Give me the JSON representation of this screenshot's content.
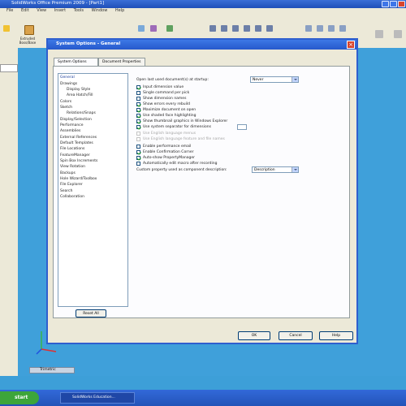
{
  "app": {
    "title": "SolidWorks Office Premium 2009 - [Part1]",
    "menu": [
      "File",
      "Edit",
      "View",
      "Insert",
      "Tools",
      "Window",
      "Help"
    ]
  },
  "toolbar": {
    "extruded_boss_label": "Extruded Boss/Base"
  },
  "status": {
    "tab_label": "Trimetric"
  },
  "taskbar": {
    "start_label": "start",
    "task_label": "SolidWorks Education..."
  },
  "dialog": {
    "title": "System Options - General",
    "tabs": [
      "System Options",
      "Document Properties"
    ],
    "tree": [
      "General",
      "Drawings",
      "Display Style",
      "Area Hatch/Fill",
      "Colors",
      "Sketch",
      "Relations/Snaps",
      "Display/Selection",
      "Performance",
      "Assemblies",
      "External References",
      "Default Templates",
      "File Locations",
      "FeatureManager",
      "Spin Box Increments",
      "View Rotation",
      "Backups",
      "Hole Wizard/Toolbox",
      "File Explorer",
      "Search",
      "Collaboration"
    ],
    "reset_label": "Reset All",
    "open_last_label": "Open last used document(s) at startup:",
    "open_last_value": "Never",
    "options": [
      {
        "label": "Input dimension value",
        "checked": true,
        "enabled": true
      },
      {
        "label": "Single command per pick",
        "checked": false,
        "enabled": true
      },
      {
        "label": "Show dimension names",
        "checked": false,
        "enabled": true
      },
      {
        "label": "Show errors every rebuild",
        "checked": true,
        "enabled": true
      },
      {
        "label": "Maximize document on open",
        "checked": true,
        "enabled": true
      },
      {
        "label": "Use shaded face highlighting",
        "checked": true,
        "enabled": true
      },
      {
        "label": "Show thumbnail graphics in Windows Explorer",
        "checked": true,
        "enabled": true
      },
      {
        "label": "Use system separator for dimensions",
        "checked": true,
        "enabled": true
      },
      {
        "label": "Use English language menus",
        "checked": false,
        "enabled": false
      },
      {
        "label": "Use English language feature and file names",
        "checked": false,
        "enabled": false
      },
      {
        "label": "Enable performance email",
        "checked": false,
        "enabled": true
      },
      {
        "label": "Enable Confirmation Corner",
        "checked": true,
        "enabled": true
      },
      {
        "label": "Auto-show PropertyManager",
        "checked": true,
        "enabled": true
      },
      {
        "label": "Automatically edit macro after recording",
        "checked": false,
        "enabled": true
      }
    ],
    "custom_property_label": "Custom property used as component description:",
    "custom_property_value": "Description",
    "buttons": {
      "ok": "OK",
      "cancel": "Cancel",
      "help": "Help"
    }
  },
  "colors": {
    "accent": "#2659cc",
    "viewport": "#3fa0da",
    "check": "#21a121"
  }
}
